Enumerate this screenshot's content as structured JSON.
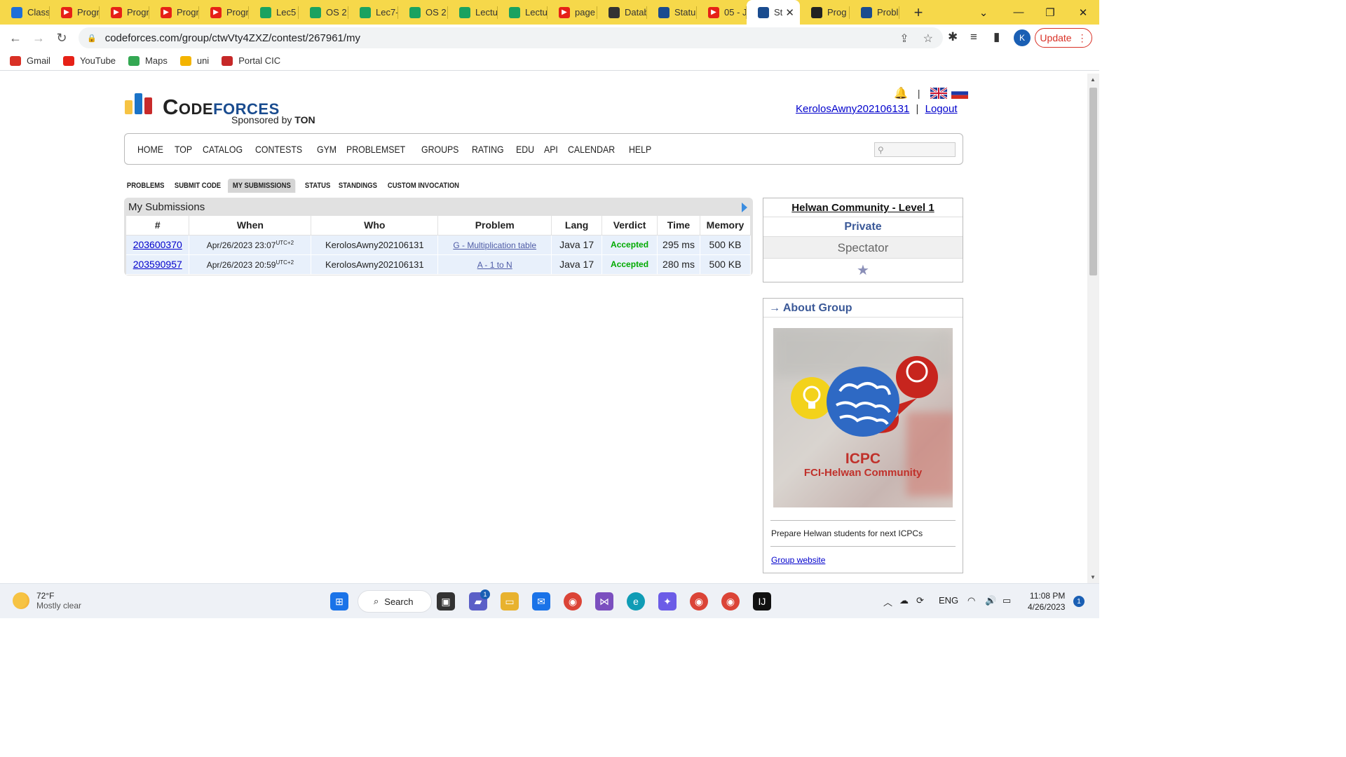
{
  "browser": {
    "tabs": [
      {
        "label": "Classr",
        "icon": "classroom-icon",
        "color": "#1e6fd9"
      },
      {
        "label": "Progr",
        "icon": "youtube-icon",
        "color": "#e62117"
      },
      {
        "label": "Progr",
        "icon": "youtube-icon",
        "color": "#e62117"
      },
      {
        "label": "Progr",
        "icon": "youtube-icon",
        "color": "#e62117"
      },
      {
        "label": "Progr",
        "icon": "youtube-icon",
        "color": "#e62117"
      },
      {
        "label": "Lec5",
        "icon": "drive-icon",
        "color": "#1aa260"
      },
      {
        "label": "OS 2",
        "icon": "drive-icon",
        "color": "#1aa260"
      },
      {
        "label": "Lec7-",
        "icon": "drive-icon",
        "color": "#1aa260"
      },
      {
        "label": "OS 2",
        "icon": "drive-icon",
        "color": "#1aa260"
      },
      {
        "label": "Lectu",
        "icon": "drive-icon",
        "color": "#1aa260"
      },
      {
        "label": "Lectu",
        "icon": "drive-icon",
        "color": "#1aa260"
      },
      {
        "label": "page",
        "icon": "youtube-icon",
        "color": "#e62117"
      },
      {
        "label": "Datab",
        "icon": "contacts-icon",
        "color": "#333333"
      },
      {
        "label": "Statu",
        "icon": "codeforces-icon",
        "color": "#1a4c8f"
      },
      {
        "label": "05 - J",
        "icon": "youtube-icon",
        "color": "#e62117"
      },
      {
        "label": "St",
        "icon": "codeforces-icon",
        "color": "#1a4c8f",
        "active": true
      },
      {
        "label": "Prog",
        "icon": "github-icon",
        "color": "#222222"
      },
      {
        "label": "Probl",
        "icon": "codeforces-icon",
        "color": "#1a4c8f"
      }
    ],
    "url": "codeforces.com/group/ctwVty4ZXZ/contest/267961/my",
    "profile_initial": "K",
    "update_label": "Update",
    "bookmarks": [
      {
        "label": "Gmail",
        "icon": "gmail-icon",
        "color": "#d93025"
      },
      {
        "label": "YouTube",
        "icon": "youtube-icon",
        "color": "#e62117"
      },
      {
        "label": "Maps",
        "icon": "maps-icon",
        "color": "#34a853"
      },
      {
        "label": "uni",
        "icon": "classroom-icon",
        "color": "#f4b400"
      },
      {
        "label": "Portal CIC",
        "icon": "portal-cic-icon",
        "color": "#c62828"
      }
    ]
  },
  "site": {
    "logo_left": "Code",
    "logo_right": "forces",
    "sponsor_prefix": "Sponsored by ",
    "sponsor_name": "TON",
    "username": "KerolosAwny202106131",
    "separator": "|",
    "logout": "Logout",
    "menu": [
      "HOME",
      "TOP",
      "CATALOG",
      "CONTESTS",
      "GYM",
      "PROBLEMSET",
      "GROUPS",
      "RATING",
      "EDU",
      "API",
      "CALENDAR",
      "HELP"
    ],
    "subtabs": [
      "PROBLEMS",
      "SUBMIT CODE",
      "MY SUBMISSIONS",
      "STATUS",
      "STANDINGS",
      "CUSTOM INVOCATION"
    ],
    "selected_subtab": "MY SUBMISSIONS"
  },
  "submissions": {
    "title": "My Submissions",
    "columns": [
      "#",
      "When",
      "Who",
      "Problem",
      "Lang",
      "Verdict",
      "Time",
      "Memory"
    ],
    "rows": [
      {
        "id": "203600370",
        "when": "Apr/26/2023 23:07",
        "tz": "UTC+2",
        "who": "KerolosAwny202106131",
        "problem": "G - Multiplication table",
        "lang": "Java 17",
        "verdict": "Accepted",
        "time": "295 ms",
        "memory": "500 KB"
      },
      {
        "id": "203590957",
        "when": "Apr/26/2023 20:59",
        "tz": "UTC+2",
        "who": "KerolosAwny202106131",
        "problem": "A - 1 to N",
        "lang": "Java 17",
        "verdict": "Accepted",
        "time": "280 ms",
        "memory": "500 KB"
      }
    ]
  },
  "sidebar": {
    "contest_name": "Helwan Community - Level 1",
    "visibility": "Private",
    "role": "Spectator",
    "star": "★",
    "about_title": "→ About Group",
    "image_text_1": "ICPC",
    "image_text_2": "FCI-Helwan Community",
    "description": "Prepare Helwan students for next ICPCs",
    "website_link": "Group website"
  },
  "taskbar": {
    "temperature": "72°F",
    "weather": "Mostly clear",
    "search_label": "Search",
    "language": "ENG",
    "time": "11:08 PM",
    "date": "4/26/2023",
    "notifications": "1",
    "teams_badge": "1"
  },
  "colors": {
    "tabbar": "#f6d84a",
    "accepted": "#00aa00",
    "link": "#0000cc",
    "brand_blue": "#1a4c8f"
  }
}
